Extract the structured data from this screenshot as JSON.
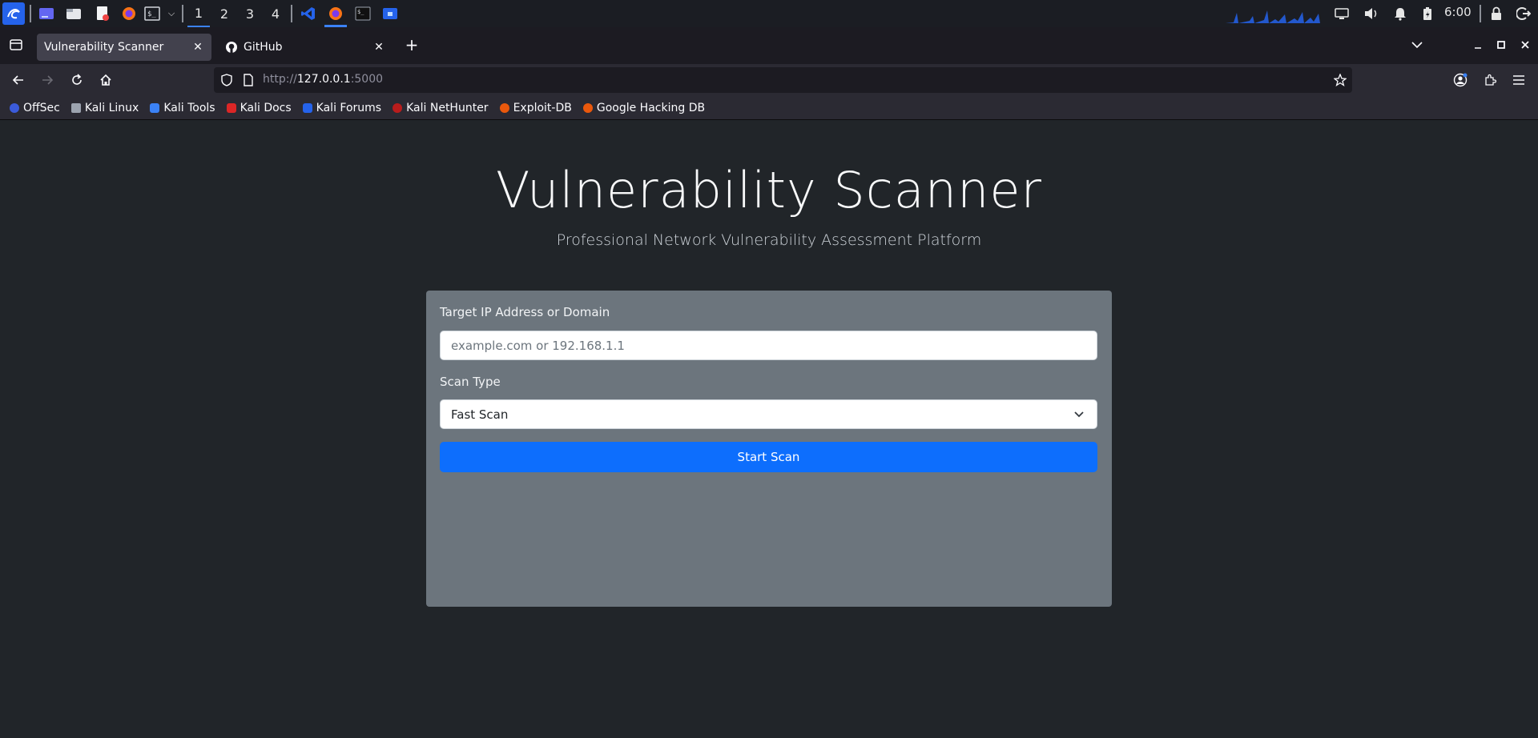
{
  "taskbar": {
    "workspaces": [
      "1",
      "2",
      "3",
      "4"
    ],
    "clock": "6:00"
  },
  "browser": {
    "tabs": [
      {
        "label": "Vulnerability Scanner",
        "active": true
      },
      {
        "label": "GitHub",
        "active": false
      }
    ],
    "url_scheme": "http://",
    "url_host": "127.0.0.1",
    "url_port": ":5000",
    "bookmarks": [
      "OffSec",
      "Kali Linux",
      "Kali Tools",
      "Kali Docs",
      "Kali Forums",
      "Kali NetHunter",
      "Exploit-DB",
      "Google Hacking DB"
    ]
  },
  "page": {
    "title": "Vulnerability Scanner",
    "subtitle": "Professional Network Vulnerability Assessment Platform",
    "form": {
      "target_label": "Target IP Address or Domain",
      "target_placeholder": "example.com or 192.168.1.1",
      "target_value": "",
      "scan_type_label": "Scan Type",
      "scan_type_value": "Fast Scan",
      "submit_label": "Start Scan"
    }
  },
  "colors": {
    "page_bg": "#212529",
    "card_bg": "#6c757d",
    "primary": "#0d6efd"
  }
}
